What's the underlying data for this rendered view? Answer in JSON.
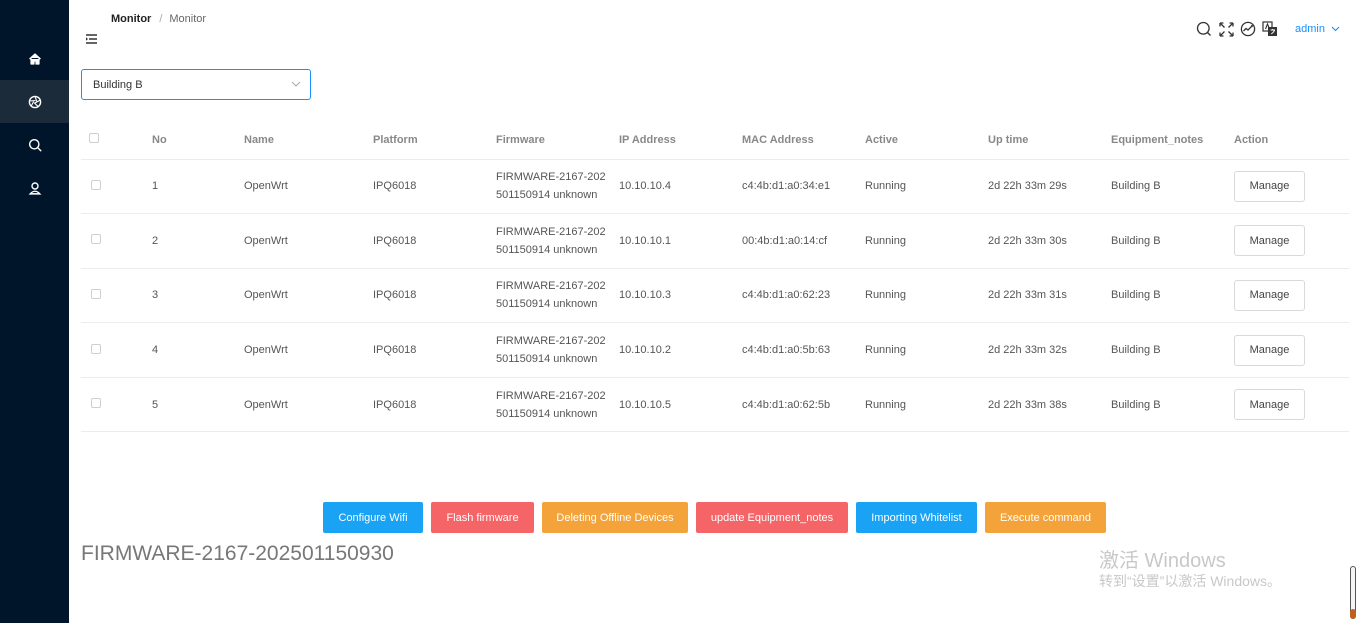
{
  "sidebar": {
    "items": [
      {
        "name": "home",
        "icon": "home-icon"
      },
      {
        "name": "monitor",
        "icon": "aperture-icon",
        "active": true
      },
      {
        "name": "search",
        "icon": "search-icon"
      },
      {
        "name": "user",
        "icon": "user-icon"
      }
    ]
  },
  "breadcrumb": {
    "level1": "Monitor",
    "separator": "/",
    "level2": "Monitor"
  },
  "header": {
    "user": "admin",
    "icons": [
      "search-icon",
      "fullscreen-icon",
      "dashboard-icon",
      "translate-icon"
    ]
  },
  "selector": {
    "value": "Building B"
  },
  "table": {
    "columns": [
      "No",
      "Name",
      "Platform",
      "Firmware",
      "IP Address",
      "MAC Address",
      "Active",
      "Up time",
      "Equipment_notes",
      "Action"
    ],
    "rows": [
      {
        "no": "1",
        "name": "OpenWrt",
        "platform": "IPQ6018",
        "firmware_l1": "FIRMWARE-2167-202",
        "firmware_l2": "501150914 unknown",
        "ip": "10.10.10.4",
        "mac": "c4:4b:d1:a0:34:e1",
        "active": "Running",
        "uptime": "2d 22h 33m 29s",
        "notes": "Building B",
        "action": "Manage"
      },
      {
        "no": "2",
        "name": "OpenWrt",
        "platform": "IPQ6018",
        "firmware_l1": "FIRMWARE-2167-202",
        "firmware_l2": "501150914 unknown",
        "ip": "10.10.10.1",
        "mac": "00:4b:d1:a0:14:cf",
        "active": "Running",
        "uptime": "2d 22h 33m 30s",
        "notes": "Building B",
        "action": "Manage"
      },
      {
        "no": "3",
        "name": "OpenWrt",
        "platform": "IPQ6018",
        "firmware_l1": "FIRMWARE-2167-202",
        "firmware_l2": "501150914 unknown",
        "ip": "10.10.10.3",
        "mac": "c4:4b:d1:a0:62:23",
        "active": "Running",
        "uptime": "2d 22h 33m 31s",
        "notes": "Building B",
        "action": "Manage"
      },
      {
        "no": "4",
        "name": "OpenWrt",
        "platform": "IPQ6018",
        "firmware_l1": "FIRMWARE-2167-202",
        "firmware_l2": "501150914 unknown",
        "ip": "10.10.10.2",
        "mac": "c4:4b:d1:a0:5b:63",
        "active": "Running",
        "uptime": "2d 22h 33m 32s",
        "notes": "Building B",
        "action": "Manage"
      },
      {
        "no": "5",
        "name": "OpenWrt",
        "platform": "IPQ6018",
        "firmware_l1": "FIRMWARE-2167-202",
        "firmware_l2": "501150914 unknown",
        "ip": "10.10.10.5",
        "mac": "c4:4b:d1:a0:62:5b",
        "active": "Running",
        "uptime": "2d 22h 33m 38s",
        "notes": "Building B",
        "action": "Manage"
      }
    ]
  },
  "actions": [
    {
      "label": "Configure Wifi",
      "color": "#1aa3f5"
    },
    {
      "label": "Flash firmware",
      "color": "#f56466"
    },
    {
      "label": "Deleting Offline Devices",
      "color": "#f3a33a"
    },
    {
      "label": "update Equipment_notes",
      "color": "#f56466"
    },
    {
      "label": "Importing Whitelist",
      "color": "#1aa3f5"
    },
    {
      "label": "Execute command",
      "color": "#f3a33a"
    }
  ],
  "firmware_version": "FIRMWARE-2167-202501150930",
  "watermark": {
    "line1": "激活 Windows",
    "line2": "转到“设置”以激活 Windows。"
  },
  "colors": {
    "sidebar": "#001529",
    "accent": "#1890ff",
    "running": "#0a8a0a"
  }
}
